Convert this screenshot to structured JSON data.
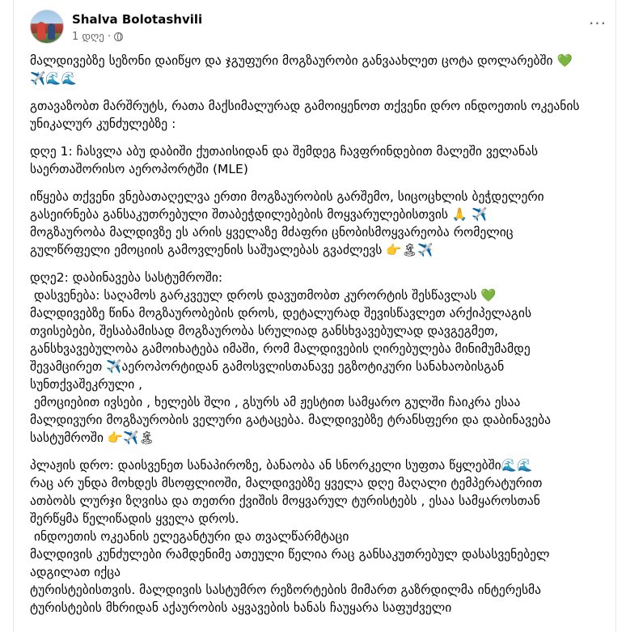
{
  "post": {
    "author": "Shalva Bolotashvili",
    "time": "1 დღე ·",
    "more_label": "···",
    "paragraphs": [
      "მალდივებზე სეზონი დაიწყო და ჯგუფური მოგზაურობი განვაახლეთ ცოტა დოლარებში 💚✈️🌊🌊",
      "გთავაზობთ მარშრუტს, რათა მაქსიმალურად გამოიყენოთ თქვენი დრო ინდოეთის ოკეანის უნიკალურ კუნძულებზე :",
      "დღე 1: ჩასვლა აბუ დაბიში ქუთაისიდან და შემდეგ ჩავფრინდებით მალეში ველანას საერთაშორისო აეროპორტში (MLE)",
      "იწყება თქვენი ვნებათაღელვა ერთი მოგზაურობის გარშემო, სიცოცხლის ბეჭდელერი გასეირნება განსაკუთრებული შთაბეჭდილებების მოყვარულებისთვის 🙏 ✈️\nმოგზაურობა მალდივზე ეს არის ყველაზე მძაფრი ცნობისმოყვარეობა რომელიც გულწრფელი ემოციის გამოვლენის საშუალებას გვაძლევს 👉🏝✈️",
      "დღე2: დაბინავება სასტუმროში:\n დასვენება: საღამოს გარკვეულ დროს დავუთმობთ კურორტის შესწავლას 💚\nმალდივებზე წინა მოგზაურობების დროს, დეტალურად შევისწავლეთ არქიპელაგის თვისებები, შესაბამისად მოგზაურობა სრულიად განსხვავებულად დავგეგმეთ, განსხვავებულობა გამოიხატება იმაში, რომ მალდივების ღირებულება მინიმუმამდე  შევამცირეთ ✈️აეროპორტიდან გამოსვლისთანავე ეგზოტიკური სანახაობისგან სუნთქვაშეკრული ,\n ემოციებით ივსები , ხელებს შლი , გსურს ამ ჟესტით სამყარო გულში ჩაიკრა ესაა მალდივური მოგზაურობის ველური გატაცება. მალდივებზე ტრანსფერი და დაბინავება სასტუმროში 👉✈️🏝",
      "პლაჟის დრო: დაისვენეთ სანაპიროზე, ბანაობა ან სნორკელი სუფთა წყლებში🌊🌊\nრაც არ უნდა მოხდეს მსოფლიოში, მალდივებზე ყველა დღე მაღალი ტემპერატურით ათბობს ლურჯი ზღვისა და თეთრი ქვიშის მოყვარულ ტურისტებს , ესაა სამყაროსთან შერწყმა წელიწადის ყველა დროს.\n ინდოეთის ოკეანის ელეგანტური და თვალწარმტაცი\nმალდივის კუნძულები რამდენიმე ათეული წელია რაც განსაკუთრებულ დასასვენებელ ადგილათ იქცა\nტურისტებისთვის. მალდივის სასტუმრო რეზორტების მიმართ გაზრდილმა ინტერესმა ტურისტების მხრიდან აქაურობის აყვავების ხანას ჩაუყარა საფუძველი"
    ]
  }
}
